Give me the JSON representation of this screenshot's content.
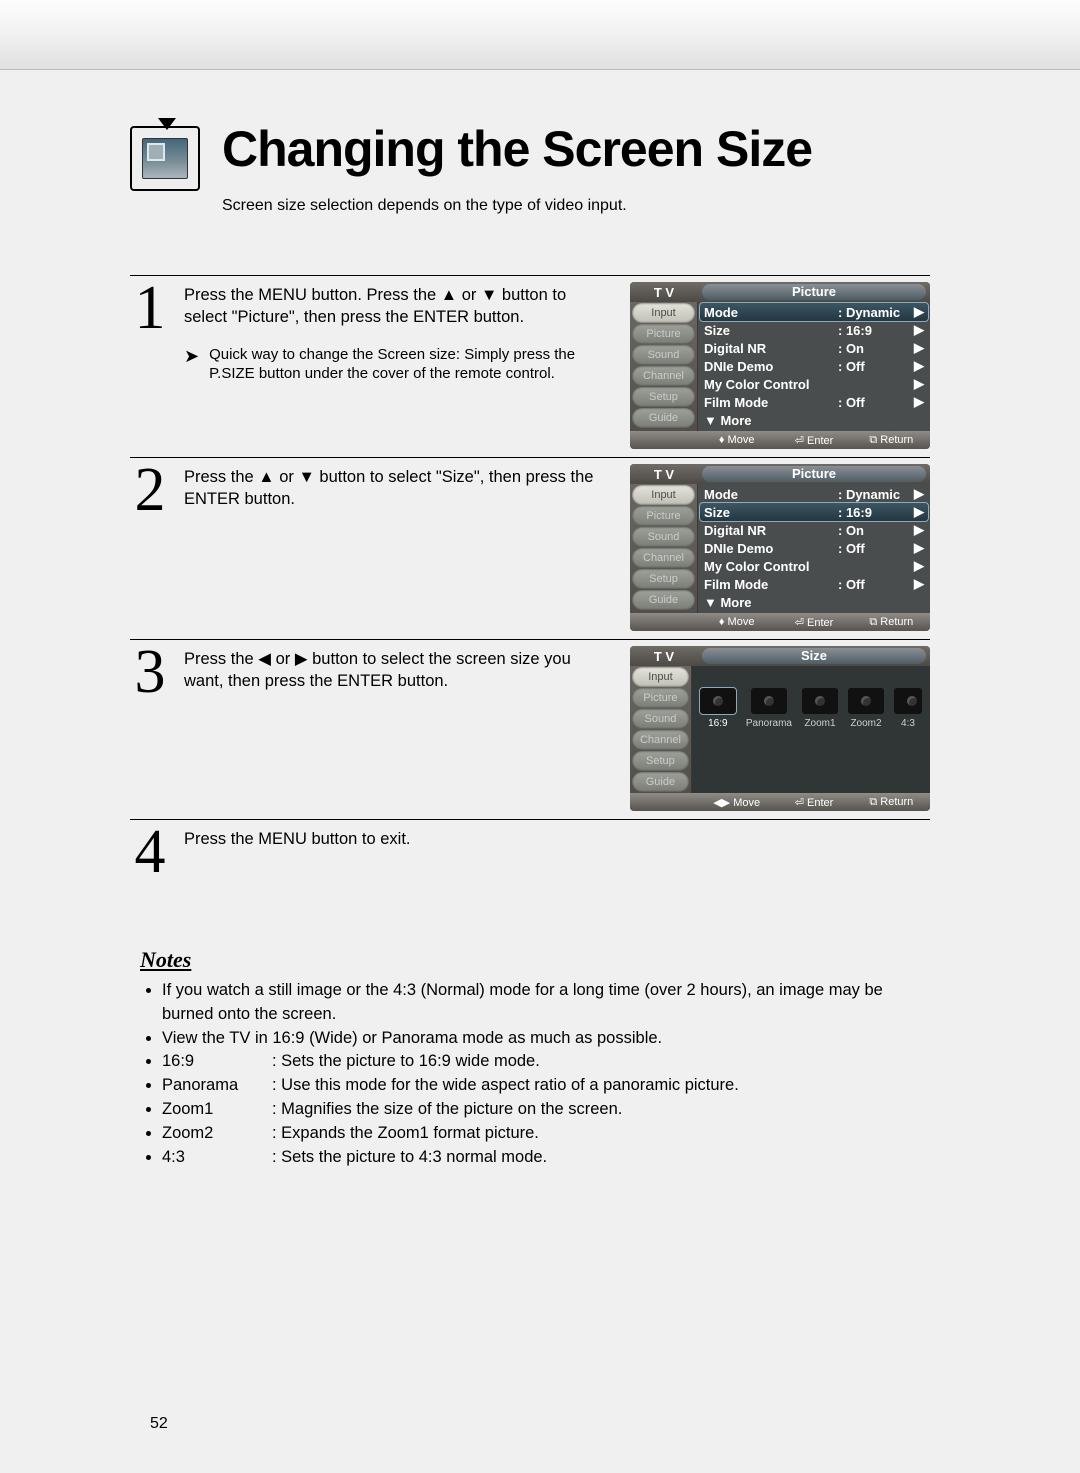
{
  "page_title": "Changing the Screen Size",
  "subtitle": "Screen size selection depends on the type of video input.",
  "steps": {
    "s1": {
      "text_a": "Press the MENU button. Press the ",
      "text_b": " or ",
      "text_c": " button to select \"Picture\", then press the ENTER button.",
      "quick": "Quick way to change the Screen size: Simply press the P.SIZE button under the cover of the remote control."
    },
    "s2": {
      "text_a": "Press the ",
      "text_b": " or ",
      "text_c": " button to select \"Size\", then press the ENTER button."
    },
    "s3": {
      "text_a": "Press the ",
      "text_b": " or ",
      "text_c": " button to select the screen size you want, then press the ENTER button."
    },
    "s4": {
      "text": "Press the MENU button to exit."
    }
  },
  "osd": {
    "tv": "T V",
    "section_picture": "Picture",
    "section_size": "Size",
    "tabs": [
      "Input",
      "Picture",
      "Sound",
      "Channel",
      "Setup",
      "Guide"
    ],
    "items": {
      "mode": "Mode",
      "mode_v": ": Dynamic",
      "size": "Size",
      "size_v": ": 16:9",
      "dnr": "Digital NR",
      "dnr_v": ": On",
      "dnie": "DNIe Demo",
      "dnie_v": ": Off",
      "mcc": "My Color Control",
      "film": "Film Mode",
      "film_v": ": Off",
      "more": "▼ More"
    },
    "footer_ud": "Move",
    "footer_lr": "Move",
    "footer_enter": "Enter",
    "footer_return": "Return",
    "size_opts": [
      "16:9",
      "Panorama",
      "Zoom1",
      "Zoom2",
      "4:3"
    ]
  },
  "notes": {
    "heading": "Notes",
    "n1": "If you watch a still image or the 4:3 (Normal) mode for a long time (over 2 hours), an image may be burned onto the screen.",
    "n2": "View the TV in 16:9 (Wide) or Panorama mode as much as possible.",
    "modes": {
      "m1l": "16:9",
      "m1d": ": Sets the picture to 16:9 wide mode.",
      "m2l": "Panorama",
      "m2d": ": Use this mode for the wide aspect ratio of a panoramic picture.",
      "m3l": "Zoom1",
      "m3d": ": Magnifies the size of the picture on the screen.",
      "m4l": "Zoom2",
      "m4d": ": Expands the Zoom1 format picture.",
      "m5l": "4:3",
      "m5d": ": Sets the picture to 4:3 normal mode."
    }
  },
  "page_number": "52",
  "glyph": {
    "up": "▲",
    "down": "▼",
    "left": "◀",
    "right": "▶",
    "lr": "◀▶",
    "ud": "♦",
    "enter": "⏎",
    "return": "⧉",
    "arrow": "➤"
  }
}
